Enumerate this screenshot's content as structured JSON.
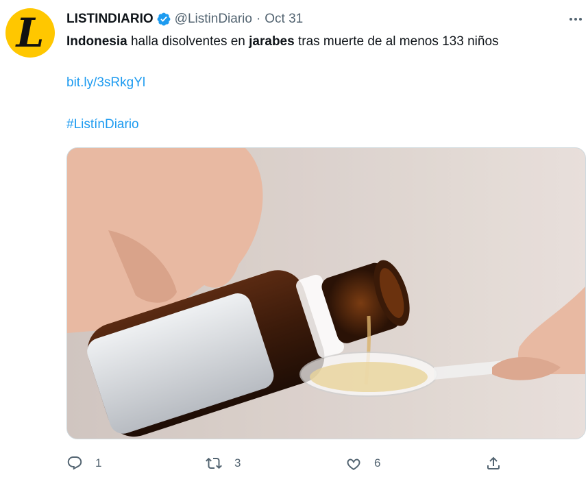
{
  "tweet": {
    "author_name": "LISTINDIARIO",
    "avatar_letter": "L",
    "handle": "@ListinDiario",
    "separator": "·",
    "date": "Oct 31",
    "text": {
      "part1": "Indonesia",
      "part2": " halla disolventes en ",
      "part3": "jarabes",
      "part4": " tras muerte de al menos 133 niños"
    },
    "link": "bit.ly/3sRkgYl",
    "hashtag": "#ListínDiario"
  },
  "actions": {
    "replies": "1",
    "retweets": "3",
    "likes": "6"
  },
  "colors": {
    "link": "#1d9bf0",
    "verified": "#1d9bf0",
    "avatar_bg": "#ffc700",
    "muted": "#536471"
  },
  "icons": [
    "verified-badge-icon",
    "more-icon",
    "reply-icon",
    "retweet-icon",
    "like-icon",
    "share-icon"
  ]
}
